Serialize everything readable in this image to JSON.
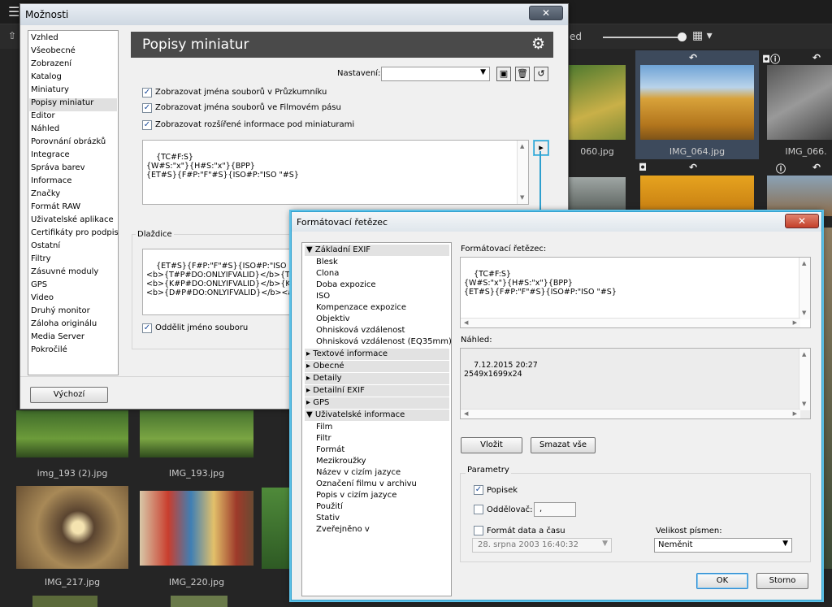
{
  "background": {
    "preview_label": "hled",
    "thumbnails": [
      {
        "label": "060.jpg"
      },
      {
        "label": "IMG_064.jpg"
      },
      {
        "label": "IMG_066."
      },
      {
        "label": "img_193 (2).jpg"
      },
      {
        "label": "IMG_193.jpg"
      },
      {
        "label": "IMG_217.jpg"
      },
      {
        "label": "IMG_220.jpg"
      }
    ]
  },
  "options_dialog": {
    "title": "Možnosti",
    "header_title": "Popisy miniatur",
    "nav_items": [
      "Vzhled",
      "Všeobecné",
      "Zobrazení",
      "Katalog",
      "Miniatury",
      "Popisy miniatur",
      "Editor",
      "Náhled",
      "Porovnání obrázků",
      "Integrace",
      "Správa barev",
      "Informace",
      "Značky",
      "Formát RAW",
      "Uživatelské aplikace",
      "Certifikáty pro podpis",
      "Ostatní",
      "Filtry",
      "Zásuvné moduly",
      "GPS",
      "Video",
      "Druhý monitor",
      "Záloha originálu",
      "Media Server",
      "Pokročilé"
    ],
    "selected_nav": "Popisy miniatur",
    "settings_label": "Nastavení:",
    "settings_value": "",
    "check_explorer": "Zobrazovat jména souborů v Průzkumníku",
    "check_filmstrip": "Zobrazovat jména souborů ve Filmovém pásu",
    "check_extended": "Zobrazovat rozšířené informace pod miniaturami",
    "format_text": "{TC#F:S}\n{W#S:\"x\"}{H#S:\"x\"}{BPP}\n{ET#S}{F#P:\"F\"#S}{ISO#P:\"ISO \"#S}",
    "tiles_label": "Dlaždice",
    "tiles_text": "{ET#S}{F#P:\"F\"#S}{ISO#P:\"ISO \"#S}{W\n<b>{T#P#DO:ONLYIFVALID}</b>{T}\n<b>{K#P#DO:ONLYIFVALID}</b>{K}\n<b>{D#P#DO:ONLYIFVALID}</b><alb>",
    "check_separate": "Oddělit jméno souboru",
    "default_button": "Výchozí"
  },
  "format_dialog": {
    "title": "Formátovací řetězec",
    "tree": [
      {
        "category": "Základní EXIF",
        "expanded": true,
        "items": [
          "Blesk",
          "Clona",
          "Doba expozice",
          "ISO",
          "Kompenzace expozice",
          "Objektiv",
          "Ohnisková vzdálenost",
          "Ohnisková vzdálenost (EQ35mm)"
        ]
      },
      {
        "category": "Textové informace",
        "expanded": false,
        "items": []
      },
      {
        "category": "Obecné",
        "expanded": false,
        "items": []
      },
      {
        "category": "Detaily",
        "expanded": false,
        "items": []
      },
      {
        "category": "Detailní EXIF",
        "expanded": false,
        "items": []
      },
      {
        "category": "GPS",
        "expanded": false,
        "items": []
      },
      {
        "category": "Uživatelské informace",
        "expanded": true,
        "items": [
          "Film",
          "Filtr",
          "Formát",
          "Mezikroužky",
          "Název v cizím jazyce",
          "Označení filmu v archivu",
          "Popis v cizím jazyce",
          "Použití",
          "Stativ",
          "Zveřejněno v"
        ]
      }
    ],
    "format_label": "Formátovací řetězec:",
    "format_text": "{TC#F:S}\n{W#S:\"x\"}{H#S:\"x\"}{BPP}\n{ET#S}{F#P:\"F\"#S}{ISO#P:\"ISO \"#S}",
    "preview_label": "Náhled:",
    "preview_text": "7.12.2015 20:27\n2549x1699x24",
    "insert_button": "Vložit",
    "clear_button": "Smazat vše",
    "params_label": "Parametry",
    "caption_check": "Popisek",
    "separator_check": "Oddělovač:",
    "separator_value": ",",
    "date_check": "Formát data a času",
    "date_value": "28. srpna 2003 16:40:32",
    "font_size_label": "Velikost písmen:",
    "font_size_value": "Neměnit",
    "ok_button": "OK",
    "cancel_button": "Storno"
  }
}
